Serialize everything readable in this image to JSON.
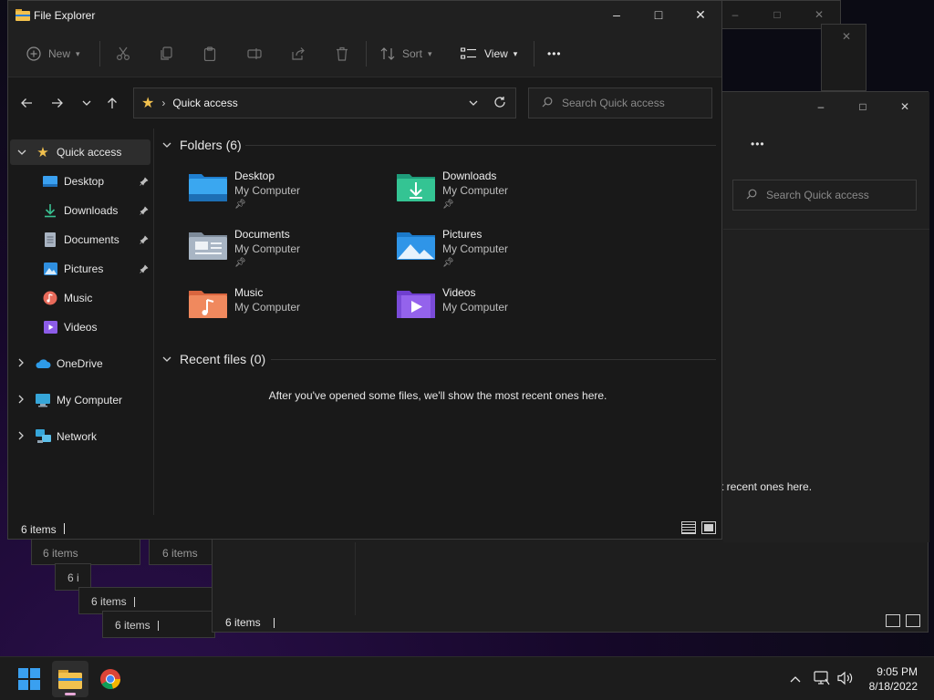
{
  "window": {
    "title": "File Explorer",
    "controls": {
      "minimize": "–",
      "maximize": "□",
      "close": "✕"
    }
  },
  "toolbar": {
    "new_label": "New",
    "sort_label": "Sort",
    "view_label": "View",
    "more_label": "•••"
  },
  "address": {
    "location": "Quick access",
    "separator": "›"
  },
  "search": {
    "placeholder": "Search Quick access"
  },
  "sidebar": {
    "items": [
      {
        "label": "Quick access",
        "icon": "star-icon"
      },
      {
        "label": "Desktop",
        "icon": "desktop-icon"
      },
      {
        "label": "Downloads",
        "icon": "download-icon"
      },
      {
        "label": "Documents",
        "icon": "document-icon"
      },
      {
        "label": "Pictures",
        "icon": "pictures-icon"
      },
      {
        "label": "Music",
        "icon": "music-icon"
      },
      {
        "label": "Videos",
        "icon": "videos-icon"
      },
      {
        "label": "OneDrive",
        "icon": "cloud-icon"
      },
      {
        "label": "My Computer",
        "icon": "computer-icon"
      },
      {
        "label": "Network",
        "icon": "network-icon"
      }
    ]
  },
  "content": {
    "folders_heading": "Folders (6)",
    "folders": [
      {
        "name": "Desktop",
        "location": "My Computer",
        "pinned": true
      },
      {
        "name": "Downloads",
        "location": "My Computer",
        "pinned": true
      },
      {
        "name": "Documents",
        "location": "My Computer",
        "pinned": true
      },
      {
        "name": "Pictures",
        "location": "My Computer",
        "pinned": true
      },
      {
        "name": "Music",
        "location": "My Computer",
        "pinned": false
      },
      {
        "name": "Videos",
        "location": "My Computer",
        "pinned": false
      }
    ],
    "recent_heading": "Recent files (0)",
    "recent_empty": "After you've opened some files, we'll show the most recent ones here."
  },
  "statusbar": {
    "count": "6 items"
  },
  "background_windows": {
    "search_placeholder": "Search Quick access",
    "partial_text": "t recent ones here.",
    "status_count": "6 items",
    "status_partial": "6 i",
    "more_label": "•••"
  },
  "taskbar": {
    "apps": [
      "start-icon",
      "file-explorer-icon",
      "chrome-icon"
    ],
    "time": "9:05 PM",
    "date": "8/18/2022"
  },
  "colors": {
    "accent_start": "#3aa0f0",
    "folder_yellow": "#f2c14e",
    "indicator": "#e7a8d8"
  }
}
